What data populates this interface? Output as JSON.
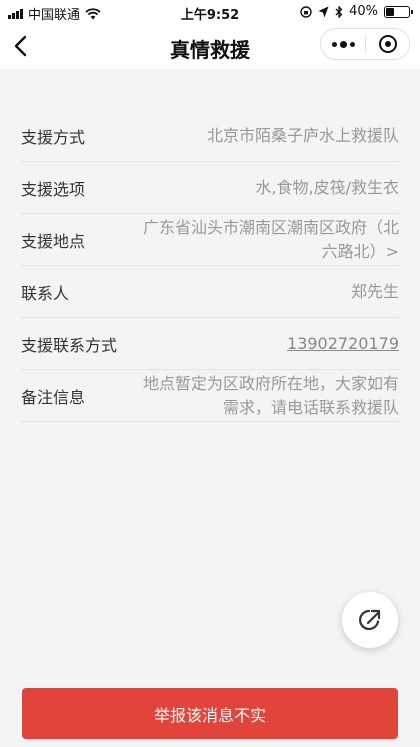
{
  "status_bar": {
    "carrier": "中国联通",
    "time": "上午9:52",
    "battery": "40%",
    "battery_level": 0.4
  },
  "nav": {
    "title": "真情救援"
  },
  "info": {
    "rows": [
      {
        "label": "支援方式",
        "value": "北京市陌桑子庐水上救援队"
      },
      {
        "label": "支援选项",
        "value": "水,食物,皮筏/救生衣"
      },
      {
        "label": "支援地点",
        "value": "广东省汕头市潮南区潮南区政府（北六路北）>"
      },
      {
        "label": "联系人",
        "value": "郑先生"
      },
      {
        "label": "支援联系方式",
        "value": "13902720179"
      },
      {
        "label": "备注信息",
        "value": "地点暂定为区政府所在地，大家如有需求，请电话联系救援队"
      }
    ]
  },
  "actions": {
    "report_label": "举报该消息不实"
  },
  "colors": {
    "accent": "#e0443a",
    "background": "#f4f4f4",
    "label": "#333333",
    "value": "#999999"
  }
}
